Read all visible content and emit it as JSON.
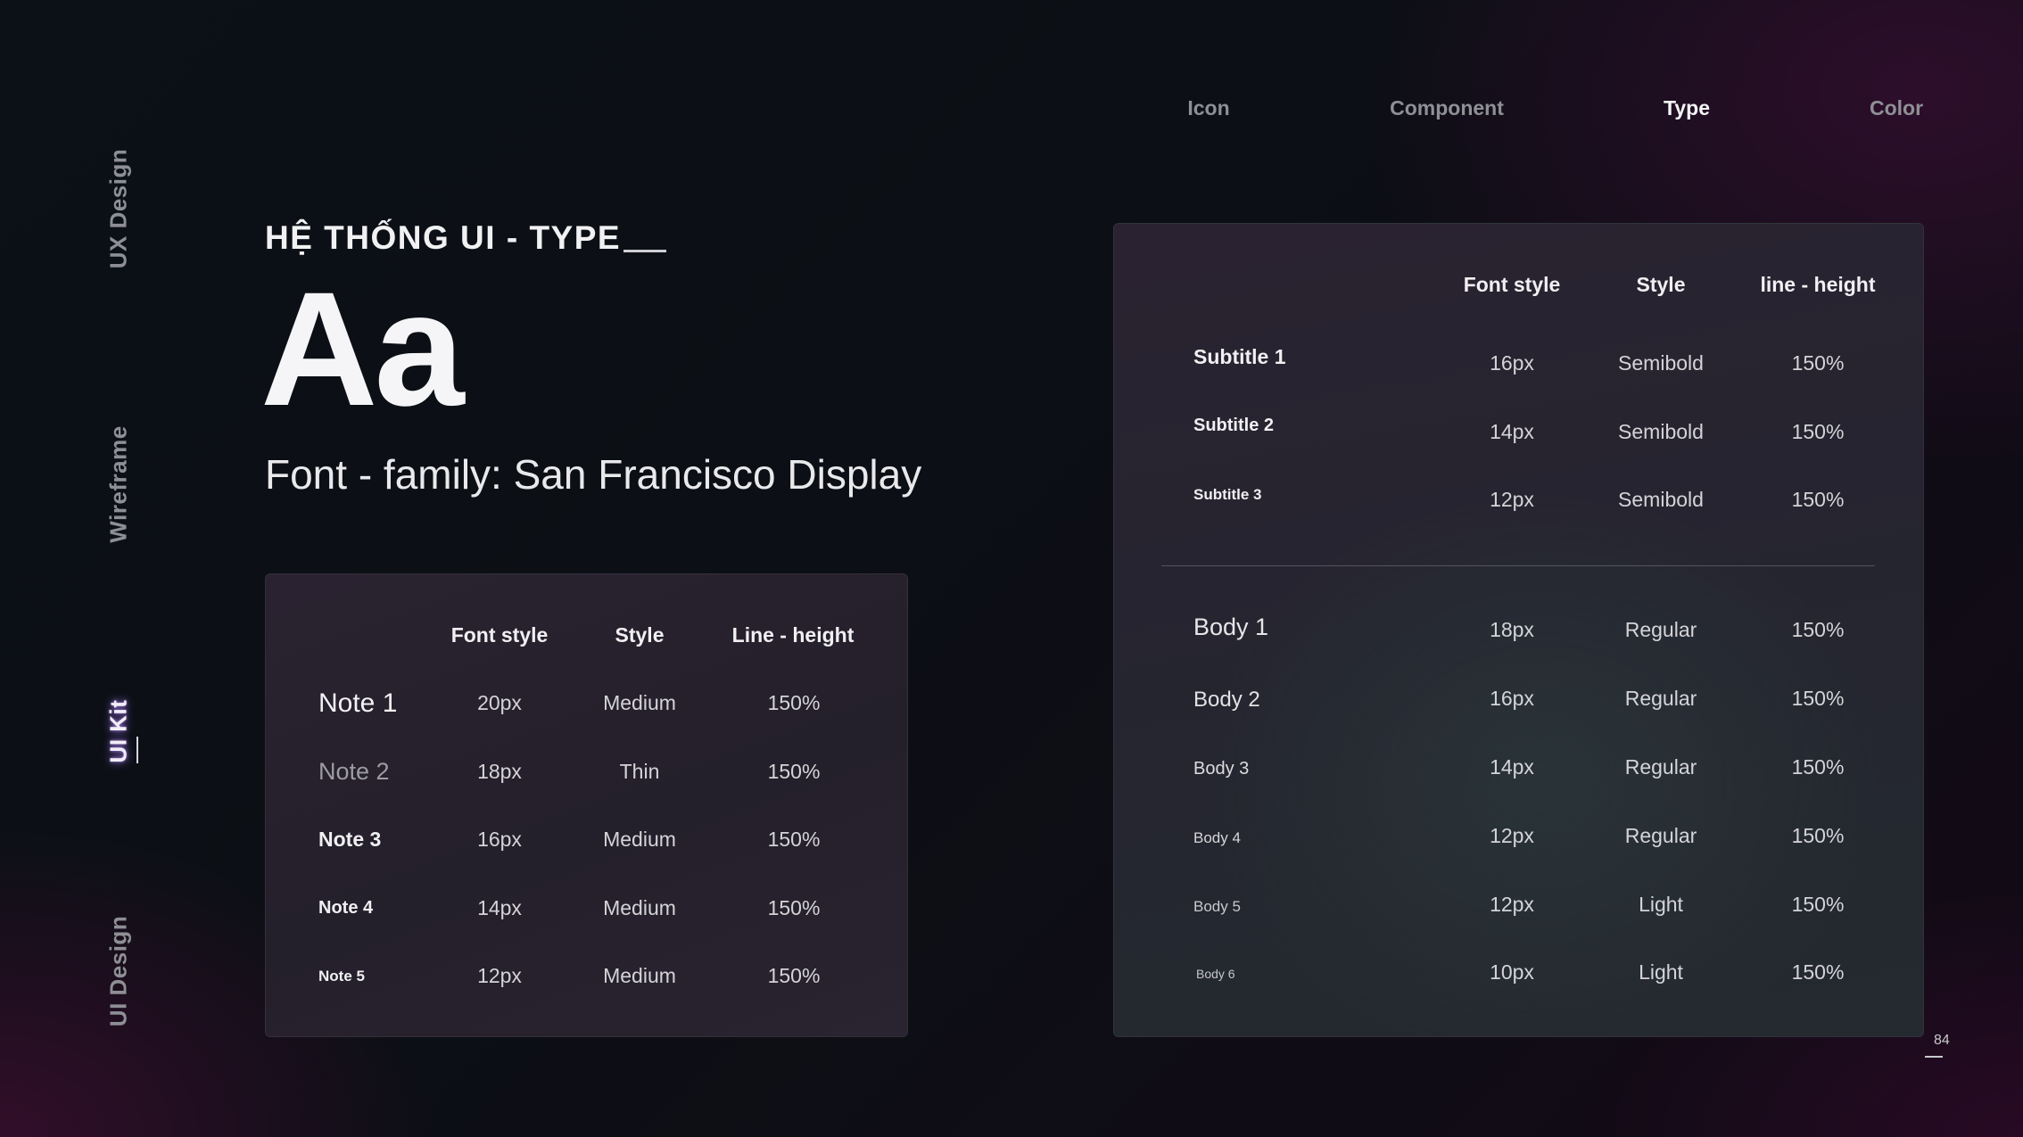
{
  "side_nav": [
    "UX Design",
    "Wireframe",
    "UI Kit",
    "UI Design"
  ],
  "top_nav": [
    "Icon",
    "Component",
    "Type",
    "Color"
  ],
  "heading": "HỆ THỐNG UI - TYPE",
  "sample": "Aa",
  "font_family": "Font - family: San Francisco Display",
  "left_table": {
    "headers": [
      "Font style",
      "Style",
      "Line - height"
    ],
    "rows": [
      {
        "name": "Note 1",
        "size": "20px",
        "style": "Medium",
        "lh": "150%"
      },
      {
        "name": "Note 2",
        "size": "18px",
        "style": "Thin",
        "lh": "150%"
      },
      {
        "name": "Note 3",
        "size": "16px",
        "style": "Medium",
        "lh": "150%"
      },
      {
        "name": "Note 4",
        "size": "14px",
        "style": "Medium",
        "lh": "150%"
      },
      {
        "name": "Note 5",
        "size": "12px",
        "style": "Medium",
        "lh": "150%"
      }
    ]
  },
  "right_table": {
    "headers": [
      "Font style",
      "Style",
      "line - height"
    ],
    "subtitles": [
      {
        "name": "Subtitle 1",
        "size": "16px",
        "style": "Semibold",
        "lh": "150%"
      },
      {
        "name": "Subtitle 2",
        "size": "14px",
        "style": "Semibold",
        "lh": "150%"
      },
      {
        "name": "Subtitle 3",
        "size": "12px",
        "style": "Semibold",
        "lh": "150%"
      }
    ],
    "bodies": [
      {
        "name": "Body 1",
        "size": "18px",
        "style": "Regular",
        "lh": "150%"
      },
      {
        "name": "Body 2",
        "size": "16px",
        "style": "Regular",
        "lh": "150%"
      },
      {
        "name": "Body 3",
        "size": "14px",
        "style": "Regular",
        "lh": "150%"
      },
      {
        "name": "Body 4",
        "size": "12px",
        "style": "Regular",
        "lh": "150%"
      },
      {
        "name": "Body 5",
        "size": "12px",
        "style": "Light",
        "lh": "150%"
      },
      {
        "name": "Body 6",
        "size": "10px",
        "style": "Light",
        "lh": "150%"
      }
    ]
  },
  "page_number": "84"
}
